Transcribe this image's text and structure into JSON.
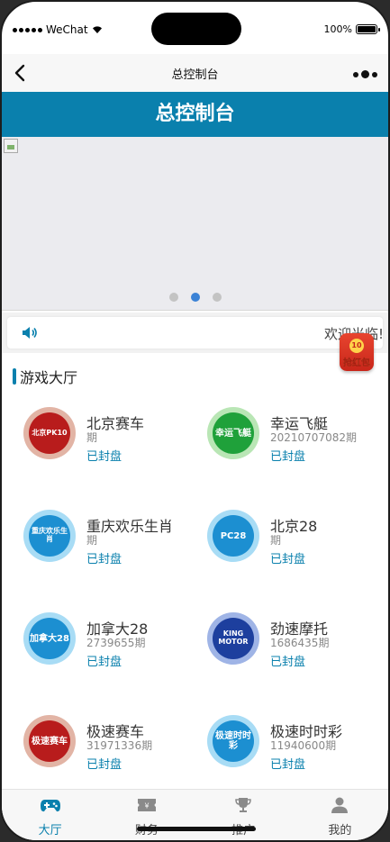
{
  "status_bar": {
    "carrier": "WeChat",
    "battery": "100%"
  },
  "nav": {
    "title": "总控制台"
  },
  "header": {
    "title": "总控制台"
  },
  "carousel": {
    "slide_count": 3,
    "active_index": 1
  },
  "notice": {
    "text": "欢迎光临!"
  },
  "red_packet": {
    "label": "抢红包",
    "coin_value": "10"
  },
  "section": {
    "title": "游戏大厅"
  },
  "games": [
    {
      "name": "北京赛车",
      "period": "期",
      "status": "已封盘",
      "logo_text": "北京PK10",
      "colors": [
        "#b81c1c",
        "#e2b4a5"
      ]
    },
    {
      "name": "幸运飞艇",
      "period": "20210707082期",
      "status": "已封盘",
      "logo_text": "幸运飞艇",
      "colors": [
        "#1fa13a",
        "#b9e6b5"
      ]
    },
    {
      "name": "重庆欢乐生肖",
      "period": "期",
      "status": "已封盘",
      "logo_text": "重庆欢乐生肖",
      "colors": [
        "#1c8fd1",
        "#a8dcf5"
      ]
    },
    {
      "name": "北京28",
      "period": "期",
      "status": "已封盘",
      "logo_text": "PC28",
      "colors": [
        "#1c8fd1",
        "#a8dcf5"
      ]
    },
    {
      "name": "加拿大28",
      "period": "2739655期",
      "status": "已封盘",
      "logo_text": "加拿大28",
      "colors": [
        "#1c8fd1",
        "#a8dcf5"
      ]
    },
    {
      "name": "劲速摩托",
      "period": "1686435期",
      "status": "已封盘",
      "logo_text": "KING MOTOR",
      "colors": [
        "#1d3f9e",
        "#9fb4e6"
      ]
    },
    {
      "name": "极速赛车",
      "period": "31971336期",
      "status": "已封盘",
      "logo_text": "极速赛车",
      "colors": [
        "#b81c1c",
        "#e2b4a5"
      ]
    },
    {
      "name": "极速时时彩",
      "period": "11940600期",
      "status": "已封盘",
      "logo_text": "极速时时彩",
      "colors": [
        "#1c8fd1",
        "#a8dcf5"
      ]
    }
  ],
  "tabs": [
    {
      "label": "大厅",
      "icon": "gamepad-icon",
      "active": true
    },
    {
      "label": "财务",
      "icon": "ticket-icon",
      "active": false
    },
    {
      "label": "推广",
      "icon": "trophy-icon",
      "active": false
    },
    {
      "label": "我的",
      "icon": "user-icon",
      "active": false
    }
  ],
  "colors": {
    "brand": "#0a80ad",
    "active_dot": "#3b82d6"
  }
}
